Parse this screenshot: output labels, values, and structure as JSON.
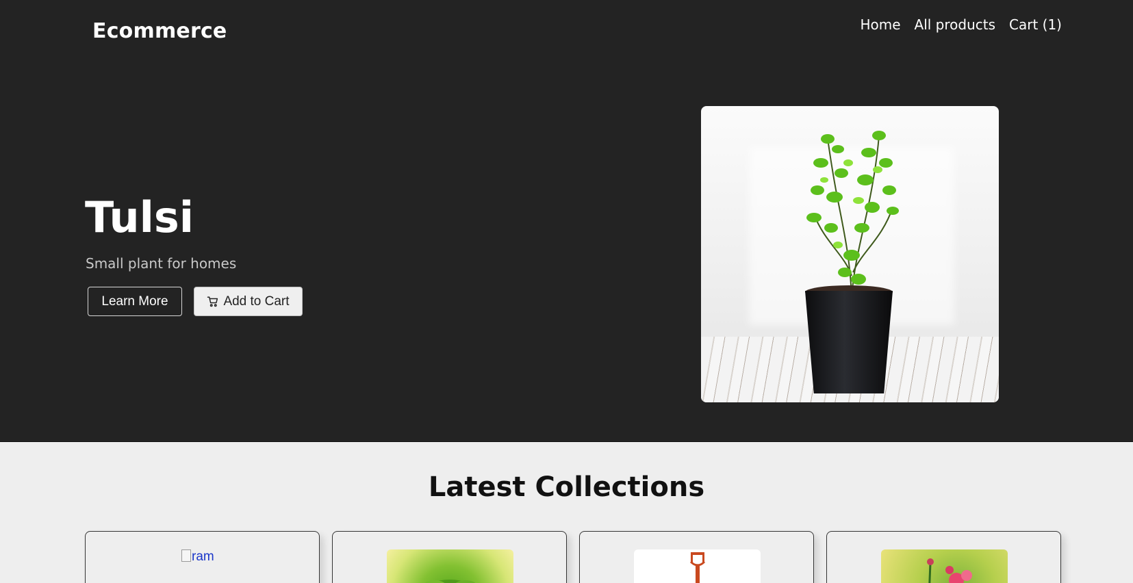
{
  "header": {
    "brand": "Ecommerce",
    "nav": [
      {
        "label": "Home"
      },
      {
        "label": "All products"
      },
      {
        "label": "Cart (1)"
      }
    ]
  },
  "hero": {
    "title": "Tulsi",
    "subtitle": "Small plant for homes",
    "learn_more_label": "Learn More",
    "add_to_cart_label": "Add to Cart",
    "image_icon": "potted-plant-image"
  },
  "collections": {
    "title": "Latest Collections",
    "cards": [
      {
        "image_alt": "ram",
        "image_state": "broken"
      },
      {
        "image_icon": "leafy-plant-image"
      },
      {
        "image_icon": "shovel-image"
      },
      {
        "image_icon": "rose-plant-image"
      }
    ]
  },
  "colors": {
    "hero_background": "#232323",
    "page_background": "#eeeeee",
    "link_broken": "#1a36c9"
  }
}
